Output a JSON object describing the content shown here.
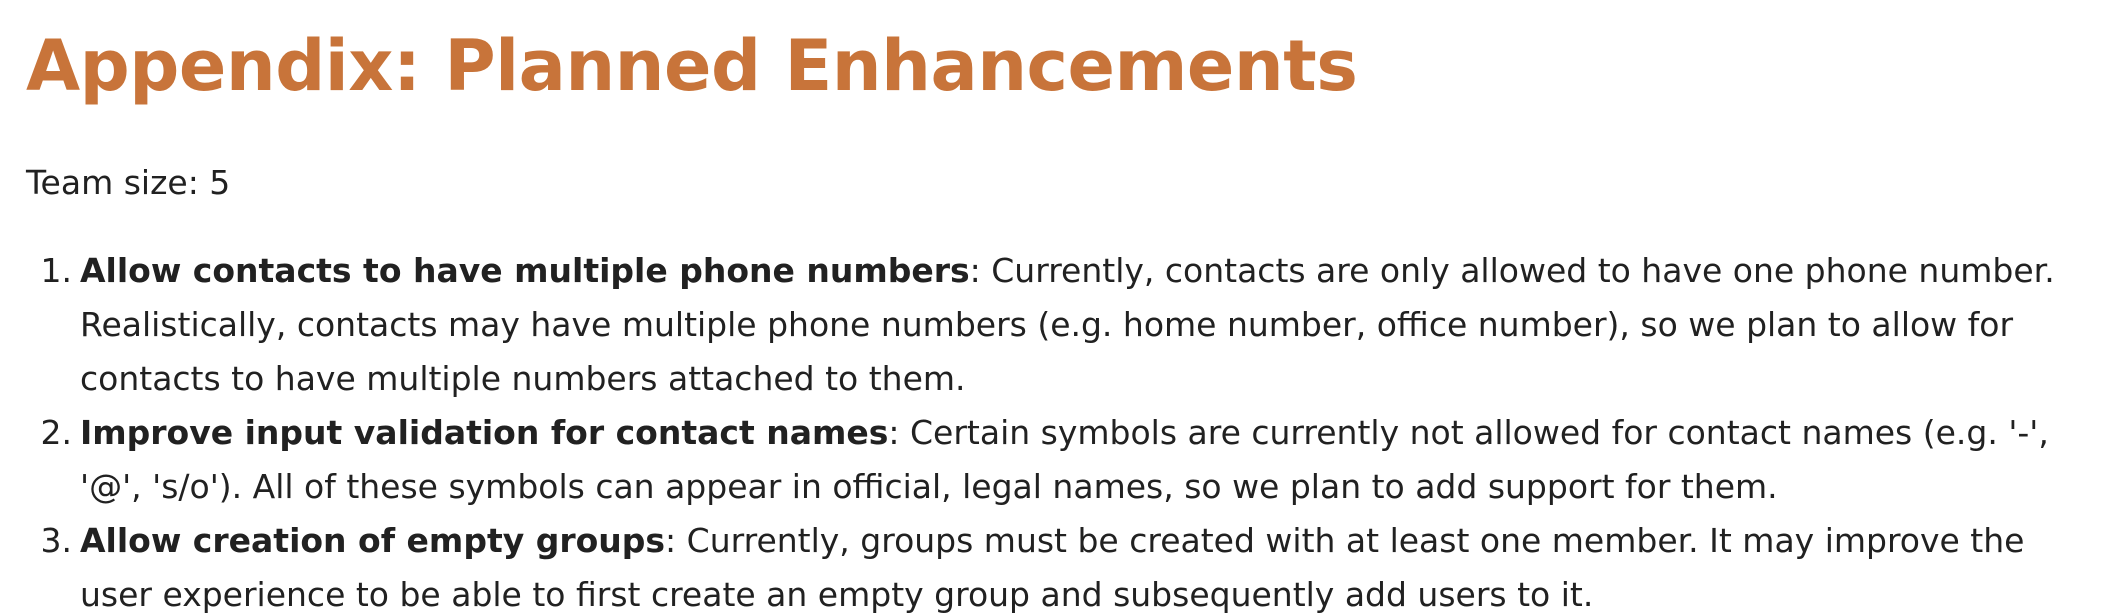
{
  "document": {
    "title": "Appendix: Planned Enhancements",
    "team_size": "Team size: 5"
  },
  "enhancements": [
    {
      "number": "1.",
      "title": "Allow contacts to have multiple phone numbers",
      "separator": ": ",
      "description": "Currently, contacts are only allowed to have one phone number. Realistically, contacts may have multiple phone numbers (e.g. home number, office number), so we plan to allow for contacts to have multiple numbers attached to them."
    },
    {
      "number": "2.",
      "title": "Improve input validation for contact names",
      "separator": ": ",
      "description": "Certain symbols are currently not allowed for contact names (e.g. '-', '@', 's/o'). All of these symbols can appear in official, legal names, so we plan to add support for them."
    },
    {
      "number": "3.",
      "title": "Allow creation of empty groups",
      "separator": ": ",
      "description": "Currently, groups must be created with at least one member. It may improve the user experience to be able to first create an empty group and subsequently add users to it."
    }
  ],
  "colors": {
    "heading": "#c8743a",
    "text": "#212121",
    "background": "#ffffff"
  }
}
